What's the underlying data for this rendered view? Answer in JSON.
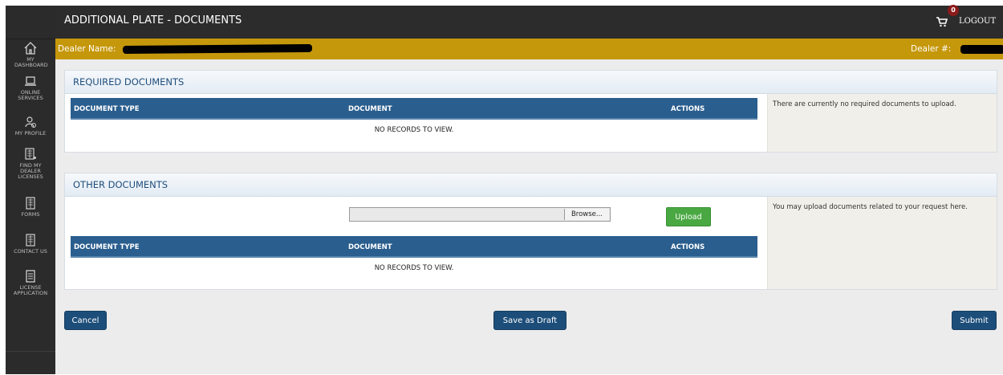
{
  "header": {
    "title": "ADDITIONAL PLATE - DOCUMENTS",
    "cart_count": "0",
    "logout": "LOGOUT"
  },
  "dealer": {
    "name_label": "Dealer Name:",
    "number_label": "Dealer #:"
  },
  "sidebar": {
    "items": [
      {
        "label": "MY DASHBOARD",
        "icon": "home-icon"
      },
      {
        "label": "ONLINE SERVICES",
        "icon": "laptop-icon"
      },
      {
        "label": "MY PROFILE",
        "icon": "profile-icon"
      },
      {
        "label": "FIND MY DEALER LICENSES",
        "icon": "find-licenses-icon"
      },
      {
        "label": "FORMS",
        "icon": "forms-icon"
      },
      {
        "label": "CONTACT US",
        "icon": "contact-icon"
      },
      {
        "label": "LICENSE APPLICATION",
        "icon": "license-application-icon"
      }
    ]
  },
  "required_documents": {
    "title": "REQUIRED DOCUMENTS",
    "columns": [
      "DOCUMENT TYPE",
      "DOCUMENT",
      "ACTIONS"
    ],
    "empty_text": "NO RECORDS TO VIEW.",
    "info": "There are currently no required documents to upload."
  },
  "other_documents": {
    "title": "OTHER DOCUMENTS",
    "browse_label": "Browse...",
    "upload_label": "Upload",
    "columns": [
      "DOCUMENT TYPE",
      "DOCUMENT",
      "ACTIONS"
    ],
    "empty_text": "NO RECORDS TO VIEW.",
    "info": "You may upload documents related to your request here."
  },
  "actions": {
    "cancel": "Cancel",
    "save_draft": "Save as Draft",
    "submit": "Submit"
  },
  "colors": {
    "sidebar": "#2b2b2b",
    "dealer_bar": "#c5970b",
    "table_header": "#2a5e8e",
    "primary_button": "#1d4e7a",
    "upload_button": "#4aa843"
  }
}
